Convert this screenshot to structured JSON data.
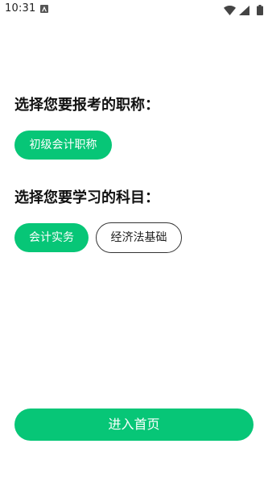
{
  "status_bar": {
    "time": "10:31",
    "icons": [
      "notification-a-icon",
      "wifi-icon",
      "signal-icon",
      "battery-icon"
    ]
  },
  "title_section": {
    "heading": "选择您要报考的职称：",
    "options": [
      {
        "label": "初级会计职称",
        "selected": true
      }
    ]
  },
  "subject_section": {
    "heading": "选择您要学习的科目：",
    "options": [
      {
        "label": "会计实务",
        "selected": true
      },
      {
        "label": "经济法基础",
        "selected": false
      }
    ]
  },
  "enter_button": {
    "label": "进入首页"
  },
  "colors": {
    "accent": "#07c677",
    "text": "#111111",
    "background": "#ffffff"
  }
}
